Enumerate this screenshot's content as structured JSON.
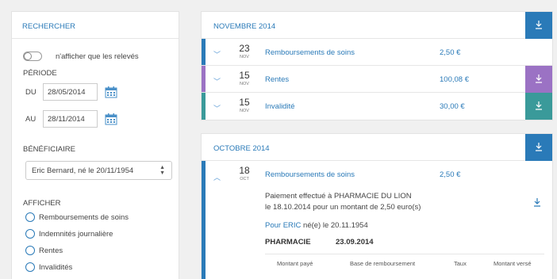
{
  "sidebar": {
    "title": "RECHERCHER",
    "toggle_label": "n'afficher que les relevés",
    "period_label": "PÉRIODE",
    "from_label": "DU",
    "from_value": "28/05/2014",
    "to_label": "AU",
    "to_value": "28/11/2014",
    "beneficiary_label": "BÉNÉFICIAIRE",
    "beneficiary_value": "Eric Bernard, né le 20/11/1954",
    "display_label": "AFFICHER",
    "filters": [
      "Remboursements de soins",
      "Indemnités journalière",
      "Rentes",
      "Invalidités"
    ]
  },
  "months": [
    {
      "title": "NOVEMBRE 2014",
      "rows": [
        {
          "day": "23",
          "month": "NOV",
          "type": "Remboursements de soins",
          "amount": "2,50 €",
          "color": "#2a7ab8"
        },
        {
          "day": "15",
          "month": "NOV",
          "type": "Rentes",
          "amount": "100,08 €",
          "color": "#9b72c4"
        },
        {
          "day": "15",
          "month": "NOV",
          "type": "Invalidité",
          "amount": "30,00 €",
          "color": "#3a9a9a"
        }
      ]
    },
    {
      "title": "OCTOBRE 2014",
      "rows": [
        {
          "day": "18",
          "month": "OCT",
          "type": "Remboursements de soins",
          "amount": "2,50 €",
          "color": "#2a7ab8"
        }
      ],
      "detail": {
        "line1": "Paiement effectué à PHARMACIE DU LION",
        "line2": "le 18.10.2014 pour un montant de 2,50 euro(s)",
        "for_link": "Pour ERIC",
        "for_rest": "né(e) le 20.11.1954",
        "category": "PHARMACIE",
        "category_date": "23.09.2014",
        "columns": [
          "Montant payé",
          "Base de remboursement",
          "Taux",
          "Montant versé"
        ]
      }
    }
  ],
  "colors": {
    "accent": "#2a7ab8",
    "rentes": "#9b72c4",
    "invalidite": "#3a9a9a"
  }
}
